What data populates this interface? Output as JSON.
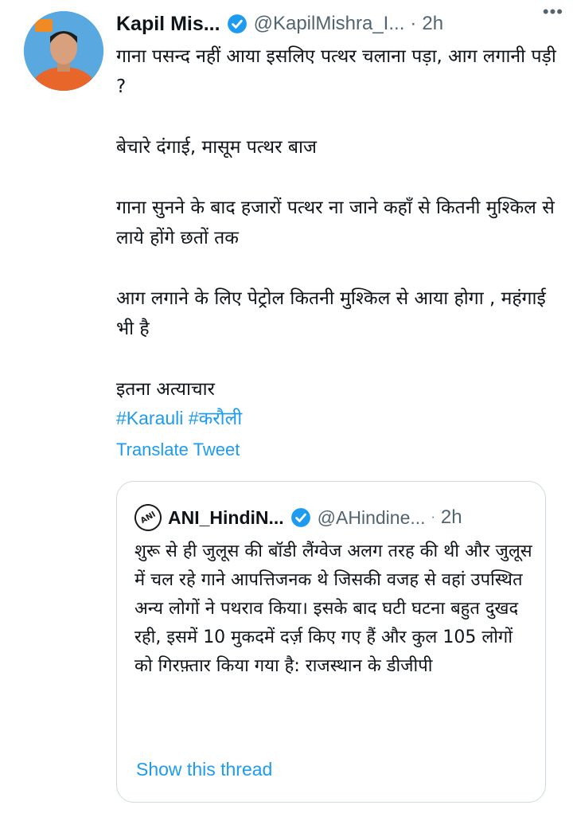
{
  "tweet": {
    "author_name": "Kapil Mis...",
    "author_handle": "@KapilMishra_I...",
    "separator": "·",
    "time": "2h",
    "more_label": "•••",
    "paragraphs": [
      "गाना पसन्द नहीं आया इसलिए पत्थर चलाना पड़ा, आग लगानी पड़ी ?",
      "बेचारे दंगाई, मासूम पत्थर बाज",
      "गाना सुनने के बाद हजारों पत्थर ना जाने कहाँ से कितनी मुश्किल से लाये होंगे छतों तक",
      "आग लगाने के लिए पेट्रोल कितनी मुश्किल से आया होगा , महंगाई भी है",
      "इतना अत्याचार"
    ],
    "hashtags": [
      "#Karauli",
      "#करौली"
    ],
    "translate_label": "Translate Tweet"
  },
  "quoted_tweet": {
    "avatar_text": "ANI",
    "author_name": "ANI_HindiN...",
    "author_handle": "@AHindine...",
    "separator": "·",
    "time": "2h",
    "text": "शुरू से ही जुलूस की बॉडी लैंग्वेज अलग तरह की थी और जुलूस में चल रहे गाने आपत्तिजनक थे जिसकी वजह से वहां उपस्थित अन्य लोगों ने पथराव किया। इसके बाद घटी घटना बहुत दुखद रही, इसमें 10 मुकदमें दर्ज़ किए गए हैं और कुल 105 लोगों को गिरफ़्तार किया गया है: राजस्थान के डीजीपी",
    "show_thread_label": "Show this thread"
  },
  "colors": {
    "link": "#1d9bf0",
    "secondary_text": "#536471",
    "border": "#cfd9de",
    "verified": "#1d9bf0"
  }
}
